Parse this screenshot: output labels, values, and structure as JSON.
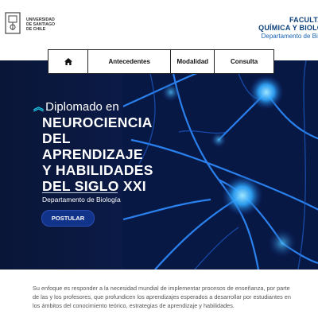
{
  "header": {
    "logo_text": "UNIVERSIDAD DE SANTIAGO DE CHILE",
    "faculty_line1": "FACULTA",
    "faculty_line2": "QUÍMICA Y BIOLO",
    "faculty_dept": "Departamento de Biol"
  },
  "nav": {
    "home_icon": "home-icon",
    "items": [
      {
        "label": "Antecedentes"
      },
      {
        "label": "Modalidad"
      },
      {
        "label": "Consulta"
      }
    ]
  },
  "hero": {
    "prefix_icon": "double-chevron-up-icon",
    "subtitle": "Diplomado en",
    "title_lines": [
      "NEUROCIENCIA",
      "DEL",
      "APRENDIZAJE",
      "Y HABILIDADES",
      "DEL SIGLO XXI"
    ],
    "department": "Departamento de Biología",
    "cta_label": "POSTULAR"
  },
  "intro": {
    "text": "Su enfoque es responder a la necesidad mundial de implementar procesos de enseñanza, por parte de las y los profesores, que profundicen los aprendizajes esperados a desarrollar por estudiantes en los ámbitos del conocimiento teórico, estrategias de aprendizaje y habilidades."
  },
  "colors": {
    "brand_blue": "#0b3f7a",
    "hero_bg": "#0a1638",
    "accent_cyan": "#21c7e6",
    "button_blue": "#12338a"
  }
}
